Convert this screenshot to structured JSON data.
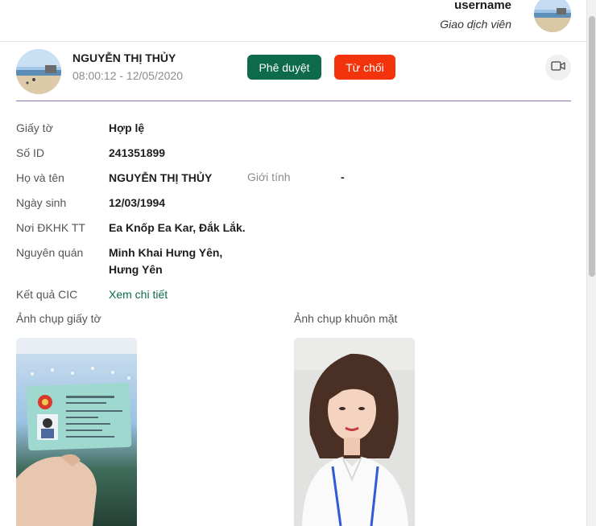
{
  "header": {
    "username": "username",
    "role": "Giao dịch viên"
  },
  "customer": {
    "name": "NGUYỄN THỊ THỦY",
    "timestamp": "08:00:12 - 12/05/2020"
  },
  "actions": {
    "approve_label": "Phê duyệt",
    "reject_label": "Từ chối",
    "video_icon": "video-camera-icon"
  },
  "fields": {
    "document_label": "Giấy tờ",
    "document_value": "Hợp lệ",
    "id_label": "Số ID",
    "id_value": "241351899",
    "fullname_label": "Họ và tên",
    "fullname_value": "NGUYỄN THỊ THỦY",
    "gender_label": "Giới tính",
    "gender_value": "-",
    "dob_label": "Ngày sinh",
    "dob_value": "12/03/1994",
    "residence_label": "Nơi ĐKHK TT",
    "residence_value": "Ea Knốp Ea Kar, Đắk Lắk.",
    "hometown_label": "Nguyên quán",
    "hometown_line1": "Minh Khai Hưng Yên,",
    "hometown_line2": "Hưng Yên",
    "cic_label": "Kết quả CIC",
    "cic_link": "Xem chi tiết"
  },
  "photos": {
    "document_photo_label": "Ảnh chụp giấy tờ",
    "face_photo_label": "Ảnh chụp khuôn mặt"
  },
  "colors": {
    "approve": "#0d6b4b",
    "reject": "#f2330c",
    "link": "#0d6b4b",
    "divider": "#8b6fb1"
  }
}
